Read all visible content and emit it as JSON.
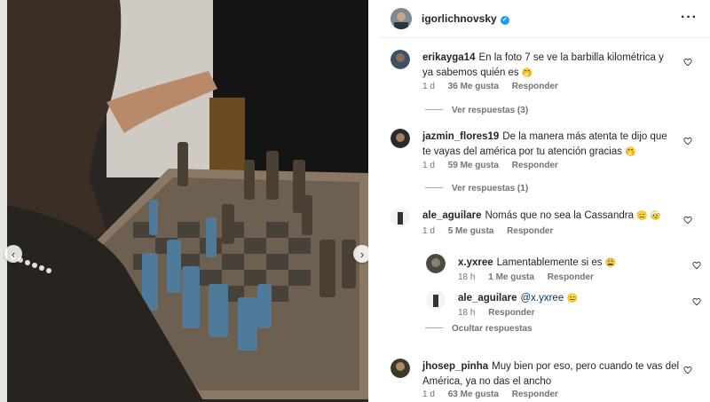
{
  "post": {
    "username": "igorlichnovsky",
    "verified": true,
    "more_icon": "more-horizontal-icon"
  },
  "photo": {
    "description_icon": "chess-photo",
    "prev_icon": "chevron-left-icon",
    "next_icon": "chevron-right-icon",
    "prev_glyph": "‹",
    "next_glyph": "›"
  },
  "comments": [
    {
      "user": "erikayga14",
      "text": "En la foto 7 se ve la barbilla kilométrica y ya sabemos quién es",
      "emoji": "🤭",
      "time": "1 d",
      "likes": "36 Me gusta",
      "reply": "Responder",
      "view_replies": "Ver respuestas (3)"
    },
    {
      "user": "jazmin_flores19",
      "text": "De la manera más atenta te dijo que te vayas del américa por tu atención gracias",
      "emoji": "🤭",
      "time": "1 d",
      "likes": "59 Me gusta",
      "reply": "Responder",
      "view_replies": "Ver respuestas (1)"
    },
    {
      "user": "ale_aguilare",
      "text": "Nomás que no sea la Cassandra",
      "emoji": "😑 🤕",
      "time": "1 d",
      "likes": "5 Me gusta",
      "reply": "Responder",
      "replies": [
        {
          "user": "x.yxree",
          "text": "Lamentablemente si es",
          "emoji": "😩",
          "time": "18 h",
          "likes": "1 Me gusta",
          "reply": "Responder"
        },
        {
          "user": "ale_aguilare",
          "mention": "@x.yxree",
          "emoji": "😑",
          "time": "18 h",
          "reply": "Responder"
        }
      ],
      "hide_replies": "Ocultar respuestas"
    },
    {
      "user": "jhosep_pinha",
      "text": "Muy bien por eso, pero cuando te vas del América, ya no das el ancho",
      "time": "1 d",
      "likes": "63 Me gusta",
      "reply": "Responder"
    }
  ],
  "colors": {
    "verified": "#1d9bf0",
    "meta": "#737373",
    "mention": "#00376b"
  }
}
